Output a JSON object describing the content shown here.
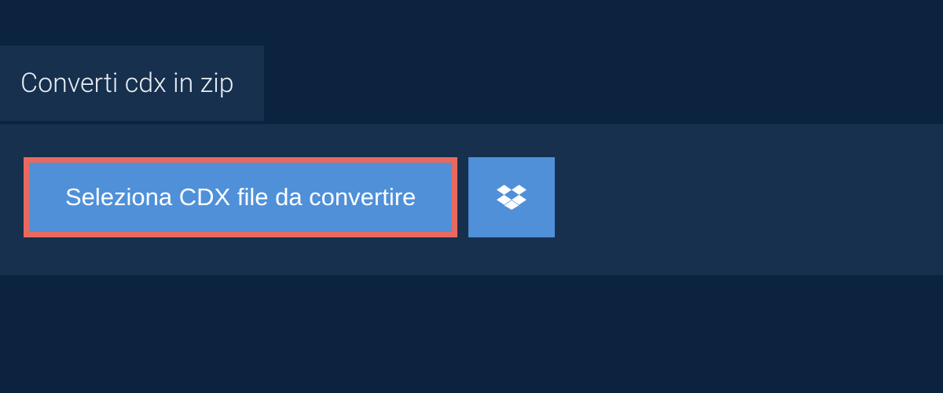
{
  "tab": {
    "title": "Converti cdx in zip"
  },
  "actions": {
    "select_file_label": "Seleziona CDX file da convertire"
  },
  "colors": {
    "background": "#0c2340",
    "panel": "#16304d",
    "accent_blue": "#4f90d9",
    "highlight_red": "#e86a5f"
  }
}
